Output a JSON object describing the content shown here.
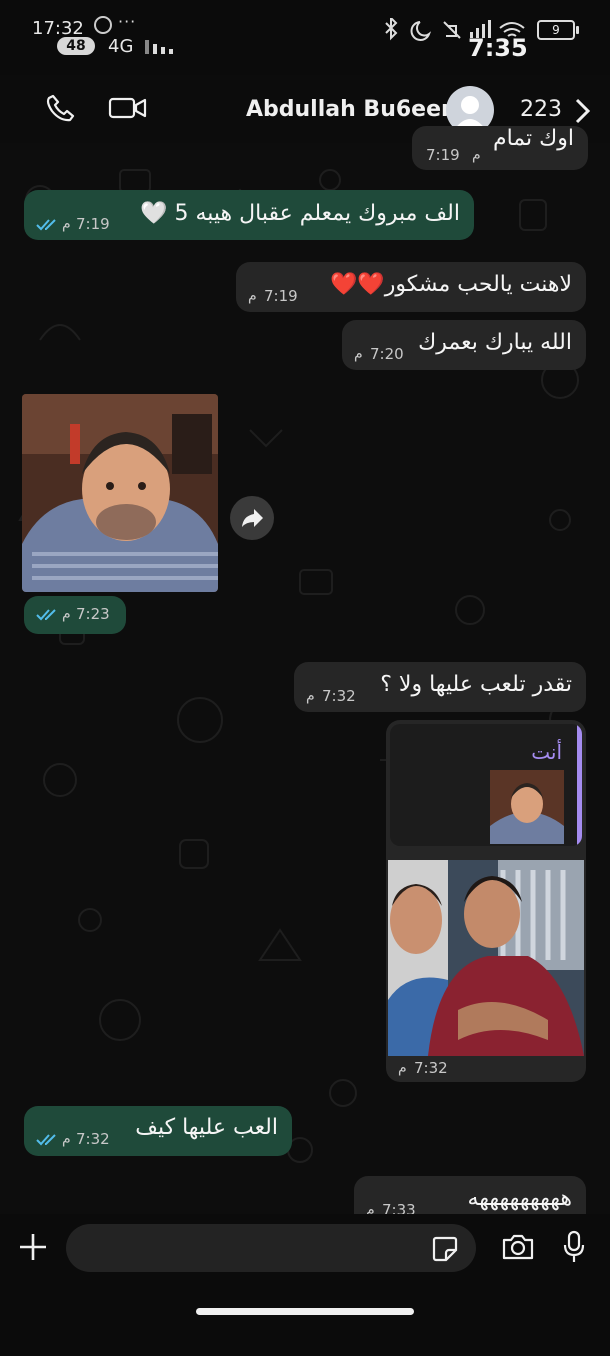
{
  "status_bar": {
    "left_time": "17:32",
    "notification_count": "48",
    "network": "4G",
    "overflow": "···",
    "right_time": "7:35",
    "battery": "9"
  },
  "header": {
    "contact_name": "Abdullah Bu6een",
    "unread_count": "223",
    "icons": [
      "phone-icon",
      "video-camera-icon",
      "avatar",
      "chevron-right-icon"
    ]
  },
  "messages": [
    {
      "direction": "in",
      "text": "اوك تمام",
      "time": "7:19",
      "suffix": "م"
    },
    {
      "direction": "out",
      "text": "الف مبروك يمعلم عقبال هيبه 5 🤍",
      "time": "7:19",
      "suffix": "م",
      "status": "read"
    },
    {
      "direction": "in",
      "text": "لاهنت يالحب مشكور❤️❤️",
      "time": "7:19",
      "suffix": "م"
    },
    {
      "direction": "in",
      "text": "الله يبارك بعمرك",
      "time": "7:20",
      "suffix": "م"
    },
    {
      "direction": "out",
      "type": "image",
      "time": "7:23",
      "suffix": "م",
      "status": "read"
    },
    {
      "direction": "in",
      "text": "تقدر تلعب عليها ولا ؟",
      "time": "7:32",
      "suffix": "م"
    },
    {
      "direction": "in",
      "type": "image-reply",
      "reply_author": "أنت",
      "time": "7:32",
      "suffix": "م"
    },
    {
      "direction": "out",
      "text": "العب عليها كيف",
      "time": "7:32",
      "suffix": "م",
      "status": "read"
    },
    {
      "direction": "in",
      "text": "هههههههههه",
      "time": "7:33",
      "suffix": "م"
    }
  ],
  "composer": {
    "placeholder": "",
    "icons": [
      "plus-icon",
      "sticker-icon",
      "camera-icon",
      "microphone-icon"
    ]
  },
  "colors": {
    "incoming_bubble": "#262626",
    "outgoing_bubble": "#1f4a3a",
    "read_ticks": "#53bdeb",
    "reply_accent": "#a58cf0"
  }
}
